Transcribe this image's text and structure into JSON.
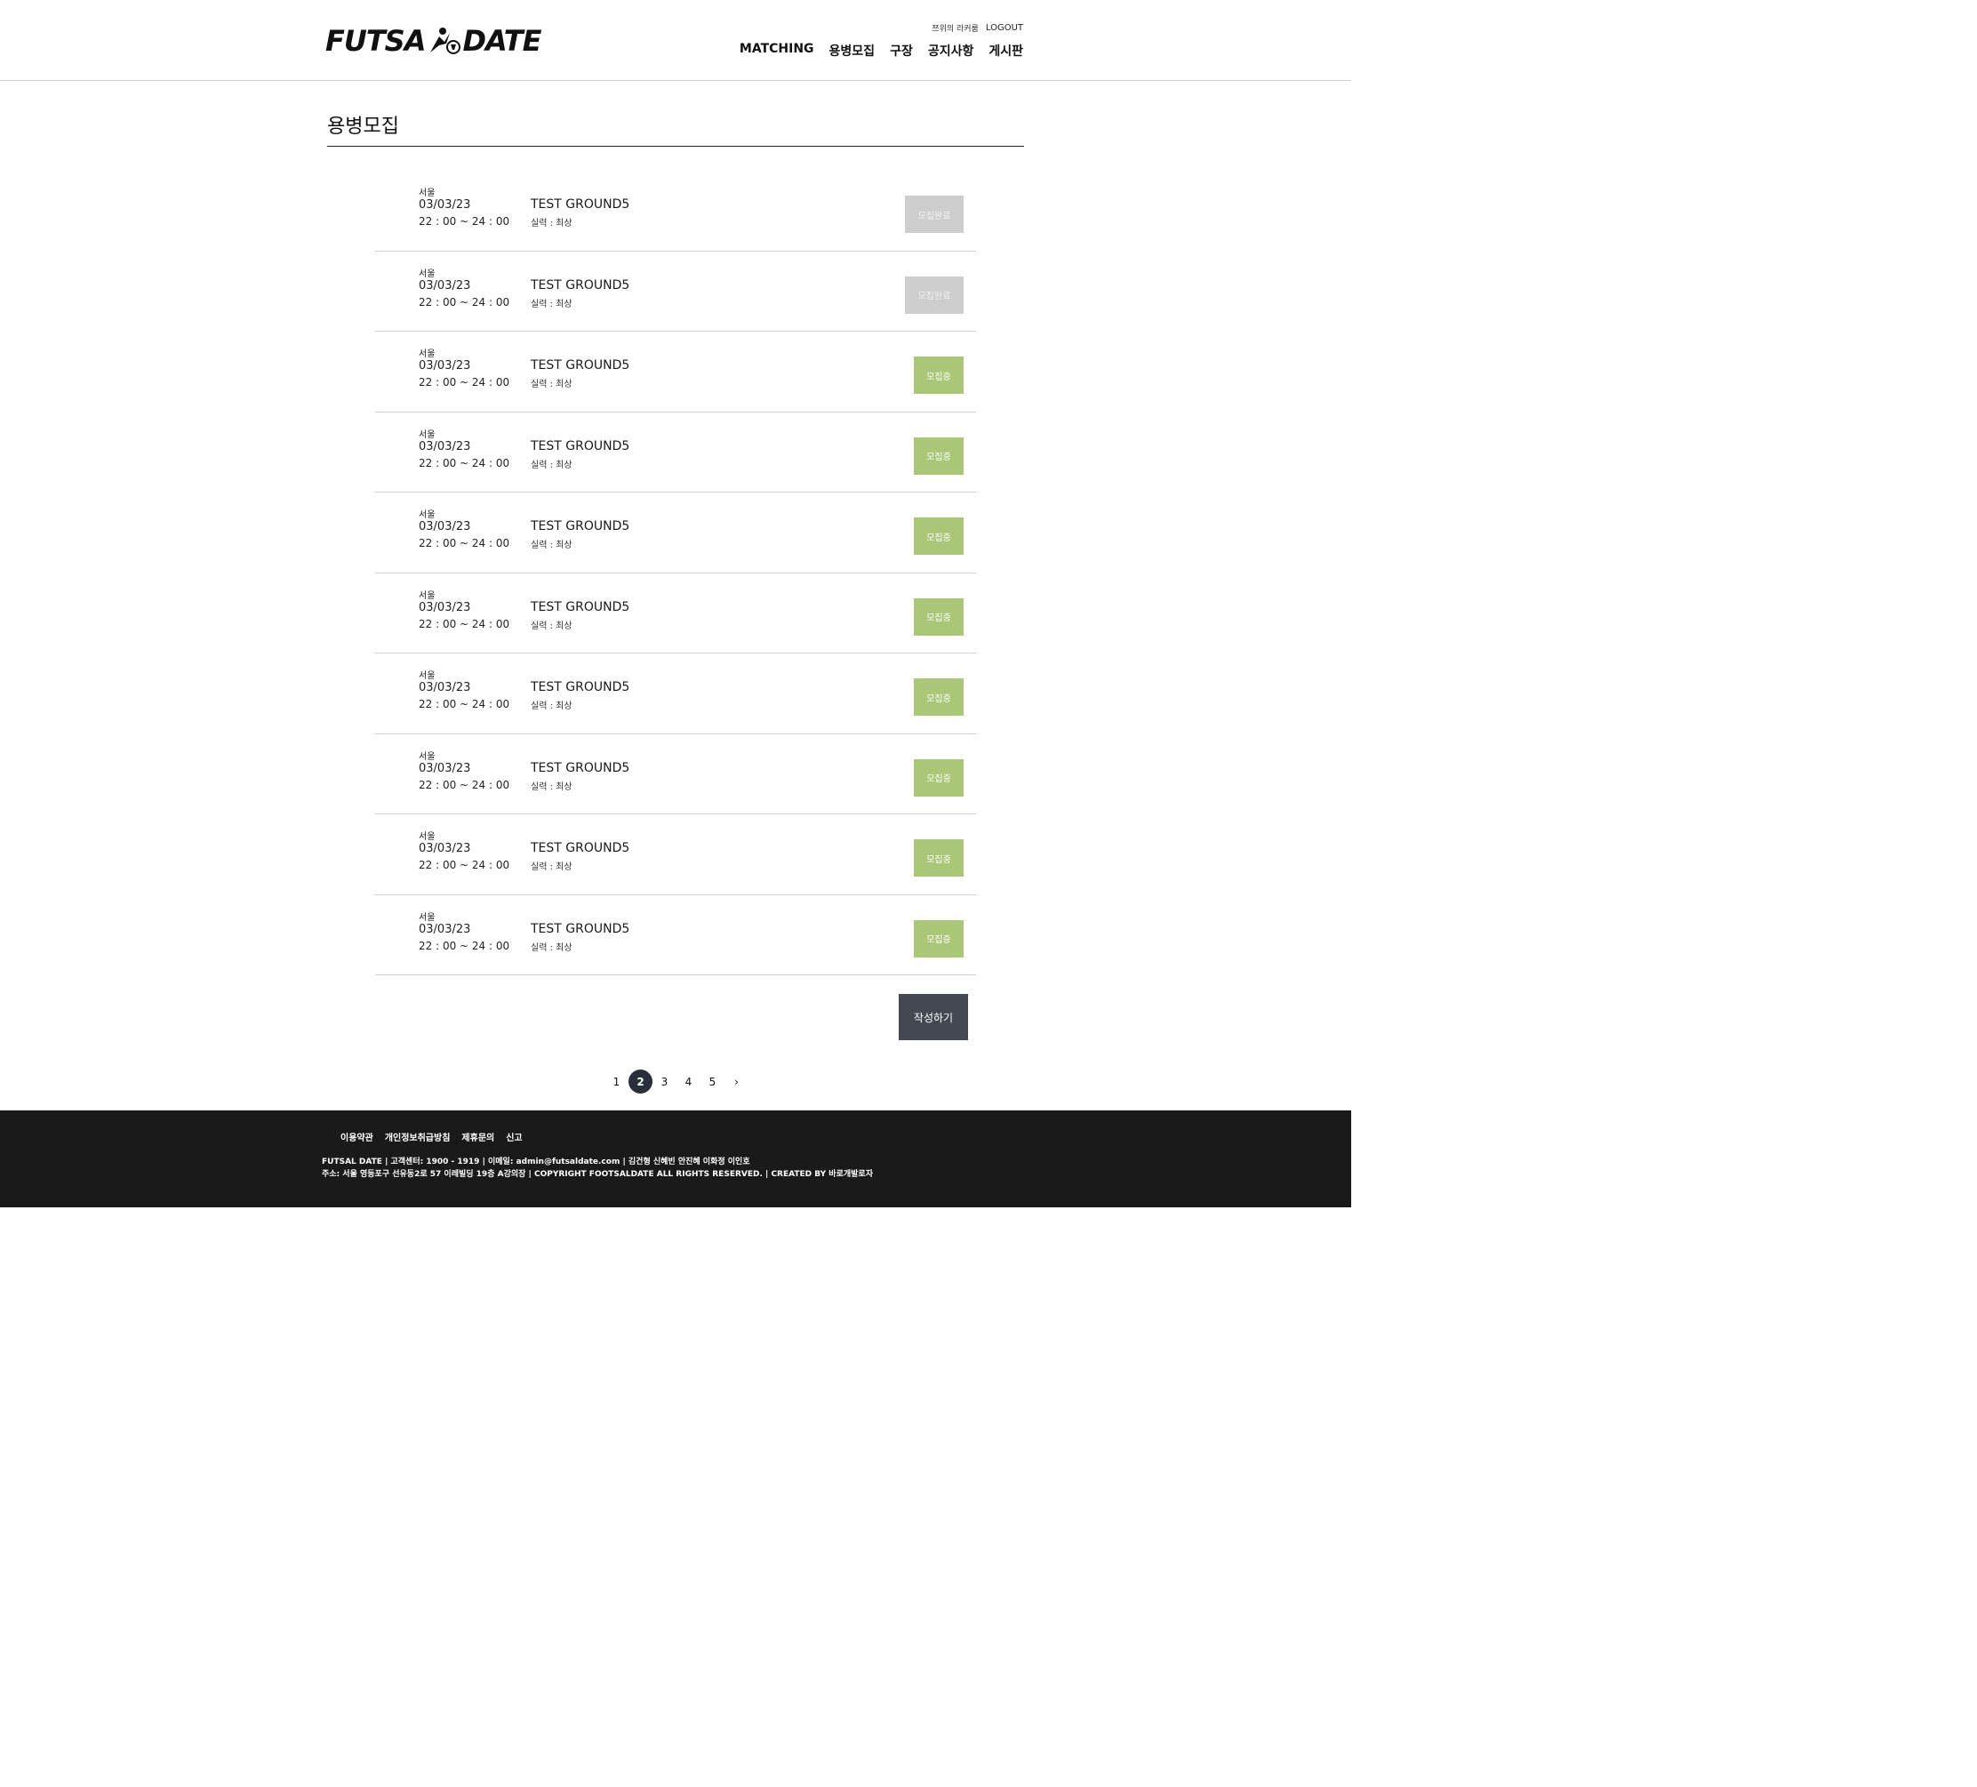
{
  "header": {
    "logo_left": "FUTSA",
    "logo_right": "DATE",
    "util": {
      "user": "쯔위의 라커룸",
      "logout": "LOGOUT"
    },
    "nav": [
      "MATCHING",
      "용병모집",
      "구장",
      "공지사항",
      "게시판"
    ]
  },
  "page": {
    "title": "용병모집"
  },
  "posts": [
    {
      "region": "서울",
      "date": "03/03/23",
      "time": "22 : 00 ~ 24 : 00",
      "ground": "TEST GROUND5",
      "skill": "실력 : 최상",
      "status": "모집완료"
    },
    {
      "region": "서울",
      "date": "03/03/23",
      "time": "22 : 00 ~ 24 : 00",
      "ground": "TEST GROUND5",
      "skill": "실력 : 최상",
      "status": "모집완료"
    },
    {
      "region": "서울",
      "date": "03/03/23",
      "time": "22 : 00 ~ 24 : 00",
      "ground": "TEST GROUND5",
      "skill": "실력 : 최상",
      "status": "모집중"
    },
    {
      "region": "서울",
      "date": "03/03/23",
      "time": "22 : 00 ~ 24 : 00",
      "ground": "TEST GROUND5",
      "skill": "실력 : 최상",
      "status": "모집중"
    },
    {
      "region": "서울",
      "date": "03/03/23",
      "time": "22 : 00 ~ 24 : 00",
      "ground": "TEST GROUND5",
      "skill": "실력 : 최상",
      "status": "모집중"
    },
    {
      "region": "서울",
      "date": "03/03/23",
      "time": "22 : 00 ~ 24 : 00",
      "ground": "TEST GROUND5",
      "skill": "실력 : 최상",
      "status": "모집중"
    },
    {
      "region": "서울",
      "date": "03/03/23",
      "time": "22 : 00 ~ 24 : 00",
      "ground": "TEST GROUND5",
      "skill": "실력 : 최상",
      "status": "모집중"
    },
    {
      "region": "서울",
      "date": "03/03/23",
      "time": "22 : 00 ~ 24 : 00",
      "ground": "TEST GROUND5",
      "skill": "실력 : 최상",
      "status": "모집중"
    },
    {
      "region": "서울",
      "date": "03/03/23",
      "time": "22 : 00 ~ 24 : 00",
      "ground": "TEST GROUND5",
      "skill": "실력 : 최상",
      "status": "모집중"
    },
    {
      "region": "서울",
      "date": "03/03/23",
      "time": "22 : 00 ~ 24 : 00",
      "ground": "TEST GROUND5",
      "skill": "실력 : 최상",
      "status": "모집중"
    }
  ],
  "write_button": "작성하기",
  "pagination": {
    "pages": [
      "1",
      "2",
      "3",
      "4",
      "5"
    ],
    "current": "2",
    "next": "›"
  },
  "footer": {
    "links": [
      "이용약관",
      "개인정보취급방침",
      "제휴문의",
      "신고"
    ],
    "line1": "FUTSAL DATE | 고객센터: 1900 - 1919 | 이메일: admin@futsaldate.com | 김건형 신혜빈 안진혜 이화정 이인호",
    "line2": "주소: 서울 영등포구 선유동2로 57 이레빌딩 19층 A강의장 | COPYRIGHT FOOTSALDATE ALL RIGHTS RESERVED. | CREATED BY 바로개발로자"
  },
  "colors": {
    "open": "#a9c776",
    "closed": "#cdcdcd",
    "write_button": "#444951",
    "footer_bg": "#1a1a1a"
  }
}
